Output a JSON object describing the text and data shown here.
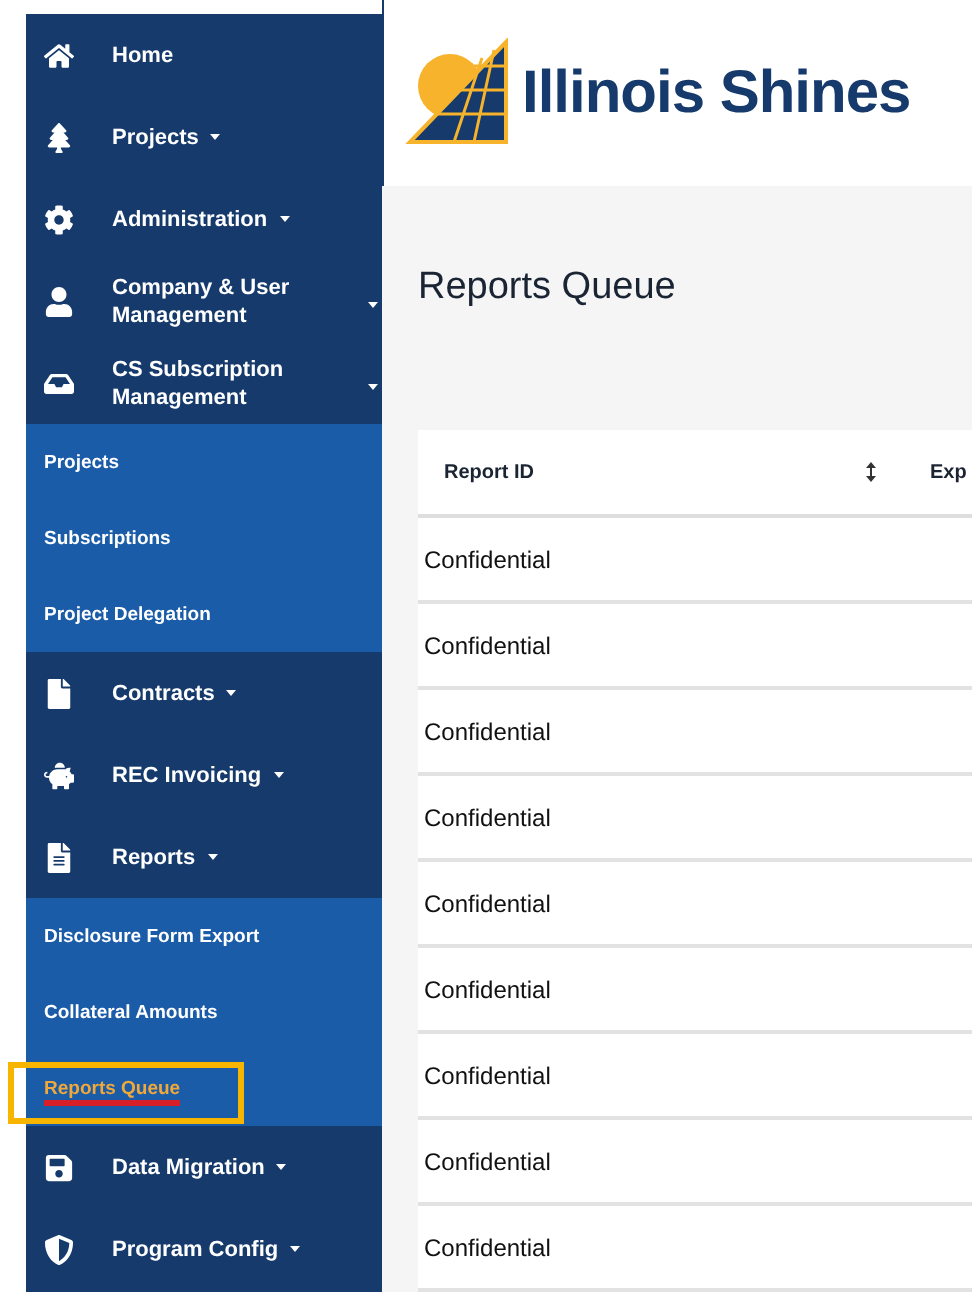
{
  "sidebar": {
    "items": [
      {
        "label": "Home",
        "kind": "link"
      },
      {
        "label": "Projects",
        "kind": "menu"
      },
      {
        "label": "Administration",
        "kind": "menu"
      },
      {
        "label": "Company & User Management",
        "kind": "edgemenu"
      },
      {
        "label": "CS Subscription Management",
        "kind": "edgemenu",
        "children": [
          {
            "label": "Projects",
            "selected": false
          },
          {
            "label": "Subscriptions",
            "selected": false
          },
          {
            "label": "Project Delegation",
            "selected": false
          }
        ]
      },
      {
        "label": "Contracts",
        "kind": "menu"
      },
      {
        "label": "REC Invoicing",
        "kind": "menu"
      },
      {
        "label": "Reports",
        "kind": "menu",
        "children": [
          {
            "label": "Disclosure Form Export",
            "selected": false
          },
          {
            "label": "Collateral Amounts",
            "selected": false
          },
          {
            "label": "Reports Queue",
            "selected": true
          }
        ]
      },
      {
        "label": "Data Migration",
        "kind": "menu"
      },
      {
        "label": "Program Config",
        "kind": "menu"
      }
    ]
  },
  "header": {
    "logo_text": "Illinois Shines"
  },
  "page": {
    "title": "Reports Queue"
  },
  "table": {
    "columns": [
      {
        "label": "Report ID",
        "kind": "sortable"
      },
      {
        "label": "Exp",
        "kind": "plain"
      }
    ],
    "rows": [
      [
        "Confidential"
      ],
      [
        "Confidential"
      ],
      [
        "Confidential"
      ],
      [
        "Confidential"
      ],
      [
        "Confidential"
      ],
      [
        "Confidential"
      ],
      [
        "Confidential"
      ],
      [
        "Confidential"
      ],
      [
        "Confidential"
      ]
    ]
  }
}
